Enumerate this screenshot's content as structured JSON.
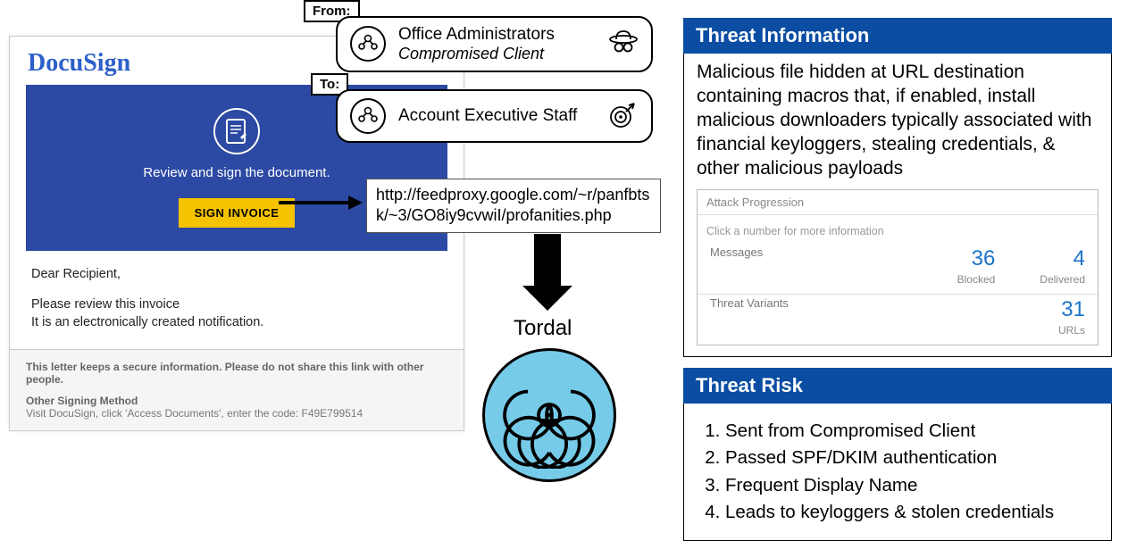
{
  "email": {
    "brand": "DocuSign",
    "banner_text": "Review and sign the document.",
    "button_label": "SIGN INVOICE",
    "greeting": "Dear Recipient,",
    "line1": "Please review this invoice",
    "line2": "It is an electronically created notification.",
    "footer_warn": "This letter keeps a secure information. Please do not share this link with other people.",
    "footer_method_title": "Other Signing Method",
    "footer_method_text": "Visit DocuSign, click 'Access Documents', enter the code: F49E799514"
  },
  "callouts": {
    "from_tag": "From:",
    "from_title": "Office Administrators",
    "from_sub": "Compromised Client",
    "to_tag": "To:",
    "to_title": "Account Executive Staff"
  },
  "url_text": "http://feedproxy.google.com/~r/panfbtsk/~3/GO8iy9cvwiI/profanities.php",
  "malware_name": "Tordal",
  "threat_info": {
    "header": "Threat Information",
    "description": "Malicious file hidden at URL destination containing macros that, if enabled, install malicious downloaders typically associated with financial keyloggers, stealing credentials, & other malicious payloads",
    "stats_title": "Attack Progression",
    "stats_hint": "Click a number for more information",
    "row1_label": "Messages",
    "blocked_num": "36",
    "blocked_label": "Blocked",
    "delivered_num": "4",
    "delivered_label": "Delivered",
    "row2_label": "Threat Variants",
    "urls_num": "31",
    "urls_label": "URLs"
  },
  "threat_risk": {
    "header": "Threat Risk",
    "items": [
      "Sent from Compromised Client",
      "Passed SPF/DKIM authentication",
      "Frequent Display Name",
      "Leads to keyloggers & stolen credentials"
    ]
  }
}
